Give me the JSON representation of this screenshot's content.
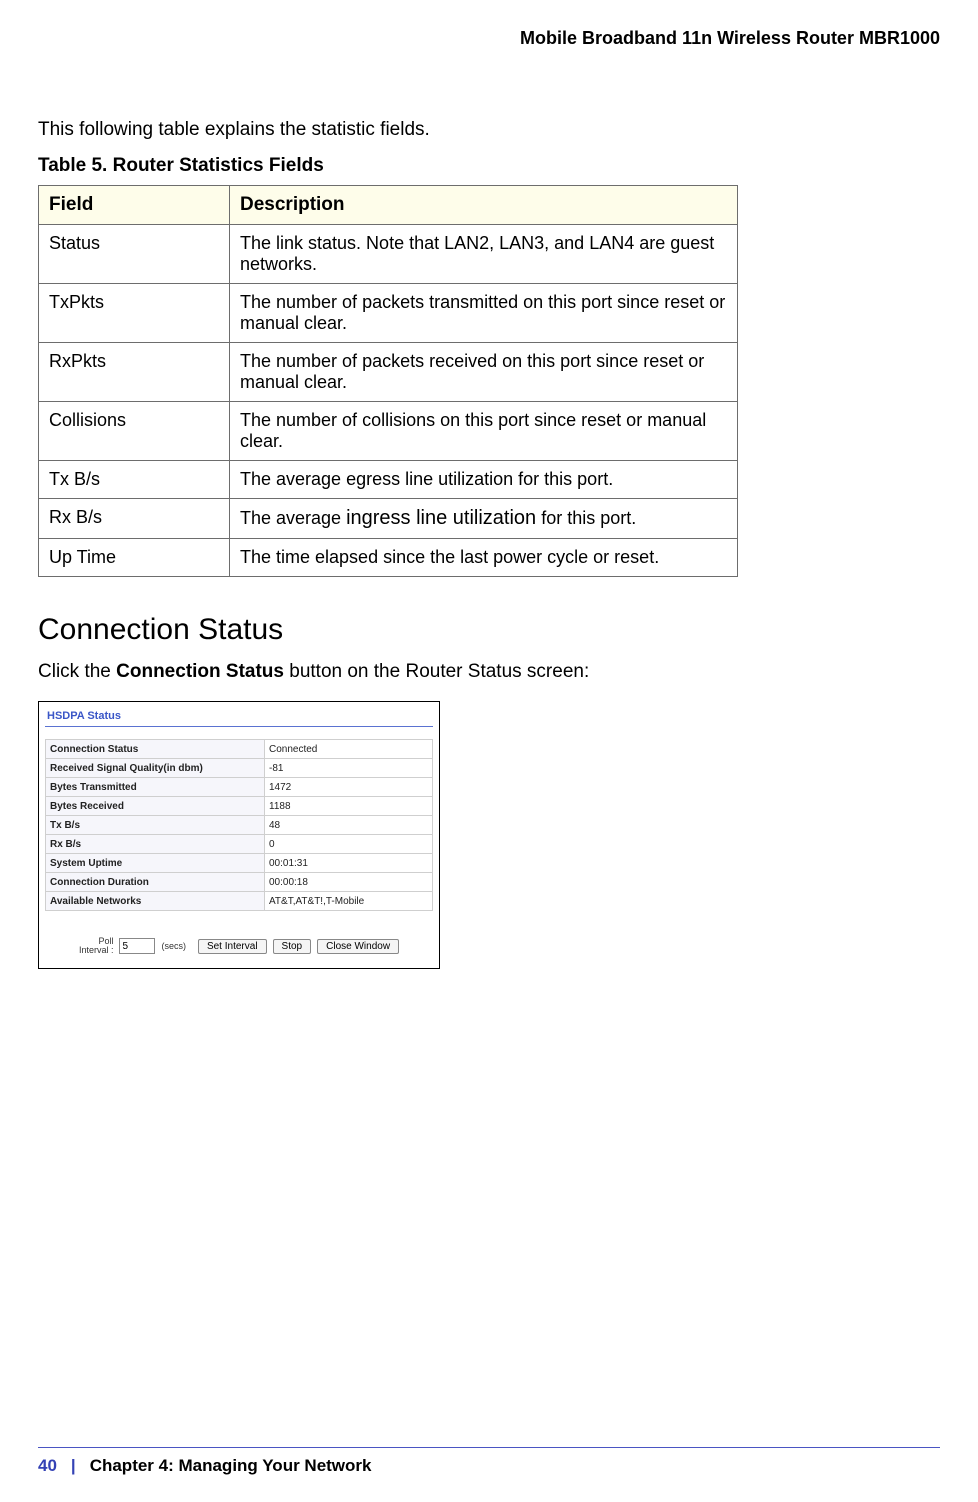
{
  "header": {
    "title": "Mobile Broadband 11n Wireless Router MBR1000"
  },
  "intro": "This following table explains the statistic fields.",
  "table_caption": "Table 5.  Router Statistics Fields",
  "fields_table": {
    "headers": {
      "field": "Field",
      "description": "Description"
    },
    "rows": [
      {
        "field": "Status",
        "desc": "The link status. Note that LAN2, LAN3, and LAN4 are guest networks."
      },
      {
        "field": "TxPkts",
        "desc": "The number of packets transmitted on this port since reset or manual clear."
      },
      {
        "field": "RxPkts",
        "desc": "The number of packets received on this port since reset or manual clear."
      },
      {
        "field": "Collisions",
        "desc": "The number of collisions on this port since reset or manual clear."
      },
      {
        "field": "Tx B/s",
        "desc": "The average egress line utilization for this port."
      },
      {
        "field": "Rx B/s",
        "desc_pre": "The average ",
        "desc_big": "ingress line utilization",
        "desc_post": " for this port."
      },
      {
        "field": "Up Time",
        "desc": "The time elapsed since the last power cycle or reset."
      }
    ]
  },
  "section_heading": "Connection Status",
  "click_line": {
    "pre": "Click the ",
    "bold": "Connection Status",
    "post": " button on the Router Status screen:"
  },
  "hsdpa": {
    "title": "HSDPA Status",
    "rows": [
      {
        "k": "Connection Status",
        "v": "Connected"
      },
      {
        "k": "Received Signal Quality(in dbm)",
        "v": "-81"
      },
      {
        "k": "Bytes Transmitted",
        "v": "1472"
      },
      {
        "k": "Bytes Received",
        "v": "1188"
      },
      {
        "k": "Tx B/s",
        "v": "48"
      },
      {
        "k": "Rx B/s",
        "v": "0"
      },
      {
        "k": "System Uptime",
        "v": "00:01:31"
      },
      {
        "k": "Connection Duration",
        "v": "00:00:18"
      },
      {
        "k": "Available Networks",
        "v": "AT&T,AT&T!,T-Mobile"
      }
    ],
    "poll_label_line1": "Poll",
    "poll_label_line2": "Interval :",
    "poll_value": "5",
    "secs": "(secs)",
    "buttons": {
      "set": "Set Interval",
      "stop": "Stop",
      "close": "Close Window"
    }
  },
  "footer": {
    "page": "40",
    "bar": "|",
    "chapter": "Chapter 4:  Managing Your Network"
  }
}
